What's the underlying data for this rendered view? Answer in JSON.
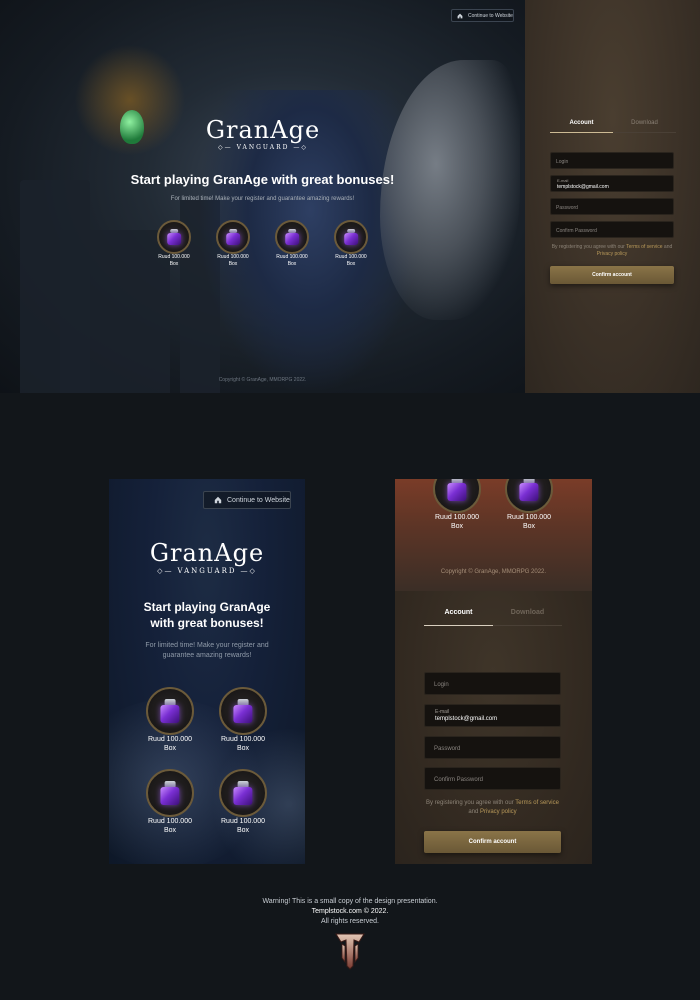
{
  "desktop": {
    "continue_label": "Continue to Website",
    "logo_main": "GranAge",
    "logo_sub": "VANGUARD",
    "headline": "Start playing GranAge with great bonuses!",
    "subline": "For limited time! Make your register and guarantee amazing rewards!",
    "rewards": [
      {
        "line1": "Ruud 100.000",
        "line2": "Box"
      },
      {
        "line1": "Ruud 100.000",
        "line2": "Box"
      },
      {
        "line1": "Ruud 100.000",
        "line2": "Box"
      },
      {
        "line1": "Ruud 100.000",
        "line2": "Box"
      }
    ],
    "copyright": "Copyright © GranAge, MMORPG 2022."
  },
  "form": {
    "tab_account": "Account",
    "tab_download": "Download",
    "login_placeholder": "Login",
    "email_label": "E-mail",
    "email_value": "templstock@gmail.com",
    "password_placeholder": "Password",
    "confirm_password_placeholder": "Confirm Password",
    "terms_prefix": "By registering you agree with our",
    "terms_link": "Terms of service",
    "terms_and": "and",
    "privacy_link": "Privacy policy",
    "confirm_label": "Confirm account"
  },
  "mobile_left": {
    "continue_label": "Continue to Website",
    "logo_main": "GranAge",
    "logo_sub": "VANGUARD",
    "headline_line1": "Start playing GranAge",
    "headline_line2": "with great bonuses!",
    "subline_line1": "For limited time! Make your register and",
    "subline_line2": "guarantee amazing rewards!",
    "rewards": [
      {
        "line1": "Ruud 100.000",
        "line2": "Box"
      },
      {
        "line1": "Ruud 100.000",
        "line2": "Box"
      },
      {
        "line1": "Ruud 100.000",
        "line2": "Box"
      },
      {
        "line1": "Ruud 100.000",
        "line2": "Box"
      }
    ]
  },
  "mobile_right": {
    "rewards": [
      {
        "line1": "Ruud 100.000",
        "line2": "Box"
      },
      {
        "line1": "Ruud 100.000",
        "line2": "Box"
      }
    ],
    "copyright": "Copyright © GranAge, MMORPG 2022."
  },
  "footer": {
    "line1": "Warning! This is a small copy of the design presentation.",
    "line2": "Templstock.com © 2022.",
    "line3": "All rights reserved."
  },
  "colors": {
    "accent_gold": "#8a7448",
    "link_gold": "#b8995a",
    "page_bg": "#12161a",
    "potion_purple": "#7a2fd3"
  },
  "icons": {
    "home": "home-icon",
    "reward": "potion-bottle-icon",
    "brand": "tiamat-emblem-icon"
  }
}
